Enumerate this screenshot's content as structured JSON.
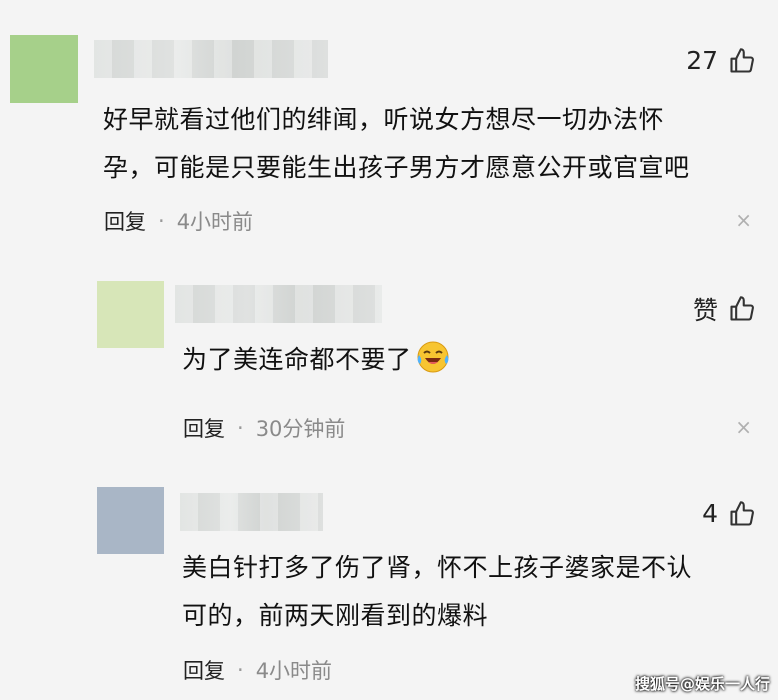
{
  "comments": [
    {
      "likes": "27",
      "text_lines": [
        "好早就看过他们的绯闻，听说女方想尽一切办法怀",
        "孕，可能是只要能生出孩子男方才愿意公开或官宣吧"
      ],
      "reply_label": "回复",
      "separator": "·",
      "time": "4小时前",
      "avatar_color": "#a6d08a"
    },
    {
      "likes": "赞",
      "text_lines": [
        "为了美连命都不要了"
      ],
      "emoji": "laughing-crying-emoji",
      "reply_label": "回复",
      "separator": "·",
      "time": "30分钟前",
      "avatar_color": "#d7e6b8"
    },
    {
      "likes": "4",
      "text_lines": [
        "美白针打多了伤了肾，怀不上孩子婆家是不认",
        "可的，前两天刚看到的爆料"
      ],
      "reply_label": "回复",
      "separator": "·",
      "time": "4小时前",
      "avatar_color": "#a9b6c6"
    }
  ],
  "close_symbol": "×",
  "watermark": "搜狐号@娱乐一人行"
}
